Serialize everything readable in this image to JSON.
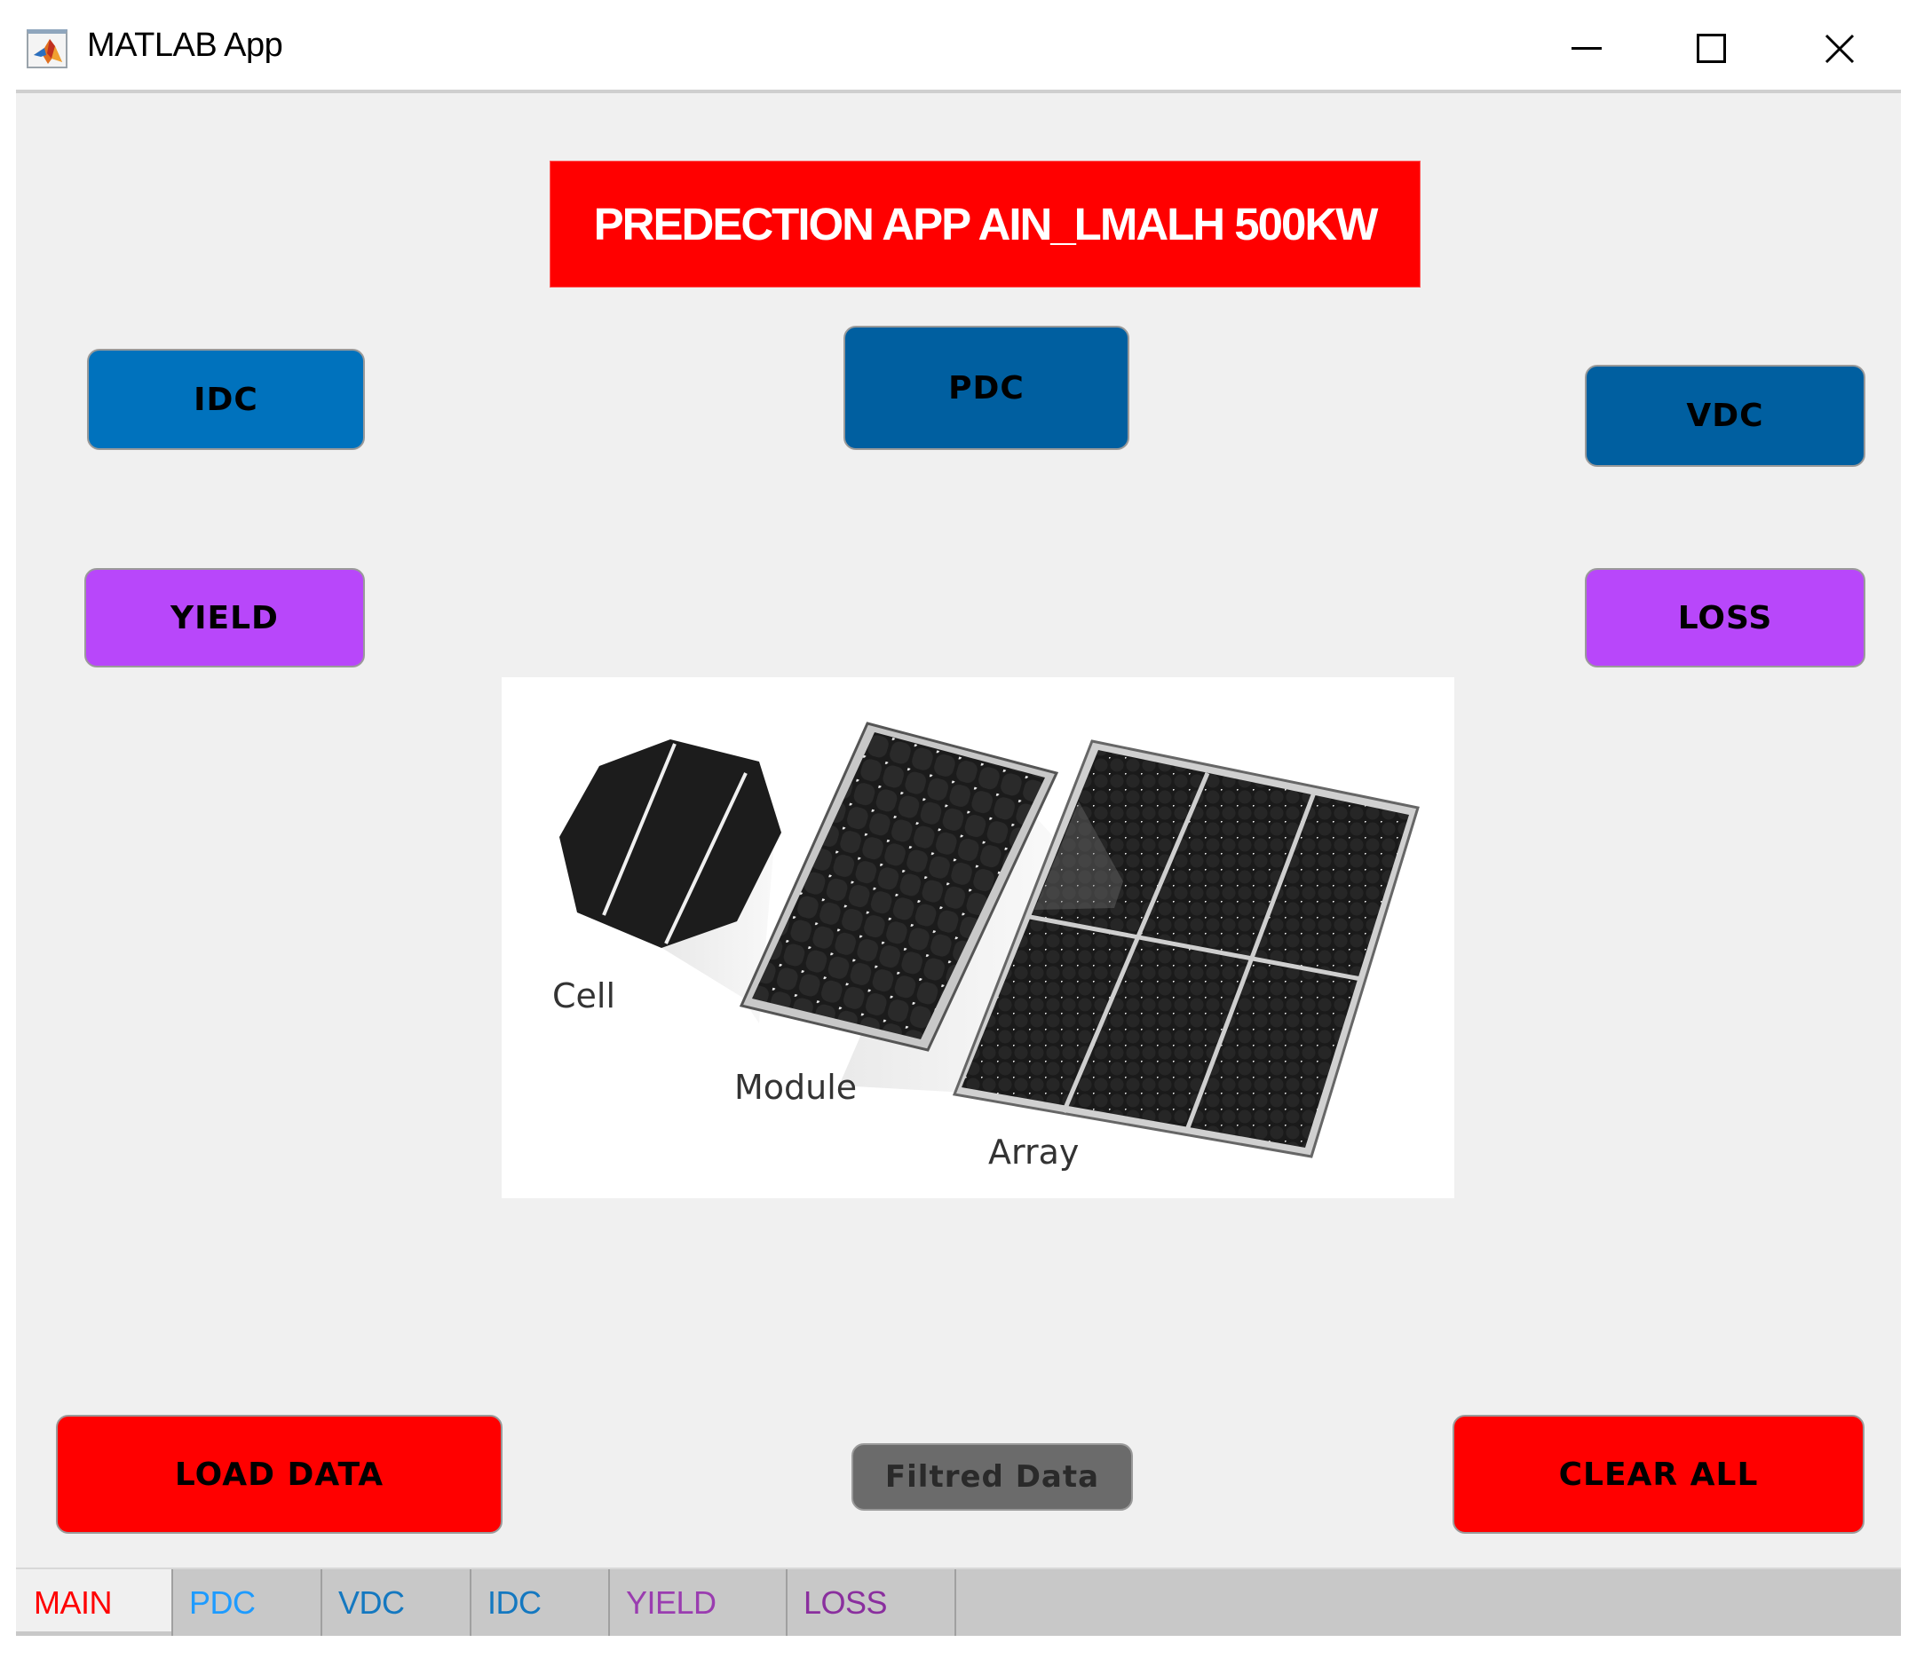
{
  "window": {
    "title": "MATLAB App",
    "icon": "matlab-logo-icon",
    "controls": [
      "minimize-icon",
      "maximize-icon",
      "close-icon"
    ]
  },
  "banner": {
    "text": "PREDECTION APP AIN_LMALH 500KW",
    "background": "#ff0000",
    "color": "#ffffff"
  },
  "buttons": {
    "idc": {
      "label": "IDC",
      "color": "#0072bd"
    },
    "pdc": {
      "label": "PDC",
      "color": "#005fa0"
    },
    "vdc": {
      "label": "VDC",
      "color": "#005fa0"
    },
    "yield": {
      "label": "YIELD",
      "color": "#b847fa"
    },
    "loss": {
      "label": "LOSS",
      "color": "#b847fa"
    },
    "load_data": {
      "label": "LOAD DATA",
      "color": "#ff0000"
    },
    "filtered_data": {
      "label": "Filtred Data",
      "color": "#6b6b6b"
    },
    "clear_all": {
      "label": "CLEAR ALL",
      "color": "#ff0000"
    }
  },
  "image": {
    "description": "solar-cell-module-array-illustration",
    "labels": {
      "cell": "Cell",
      "module": "Module",
      "array": "Array"
    }
  },
  "tabs": [
    {
      "label": "MAIN",
      "color": "#ff0000",
      "active": true
    },
    {
      "label": "PDC",
      "color": "#1e9bff",
      "active": false
    },
    {
      "label": "VDC",
      "color": "#1478c0",
      "active": false
    },
    {
      "label": "IDC",
      "color": "#1478c0",
      "active": false
    },
    {
      "label": "YIELD",
      "color": "#9a3db0",
      "active": false
    },
    {
      "label": "LOSS",
      "color": "#8a2f9e",
      "active": false
    }
  ]
}
